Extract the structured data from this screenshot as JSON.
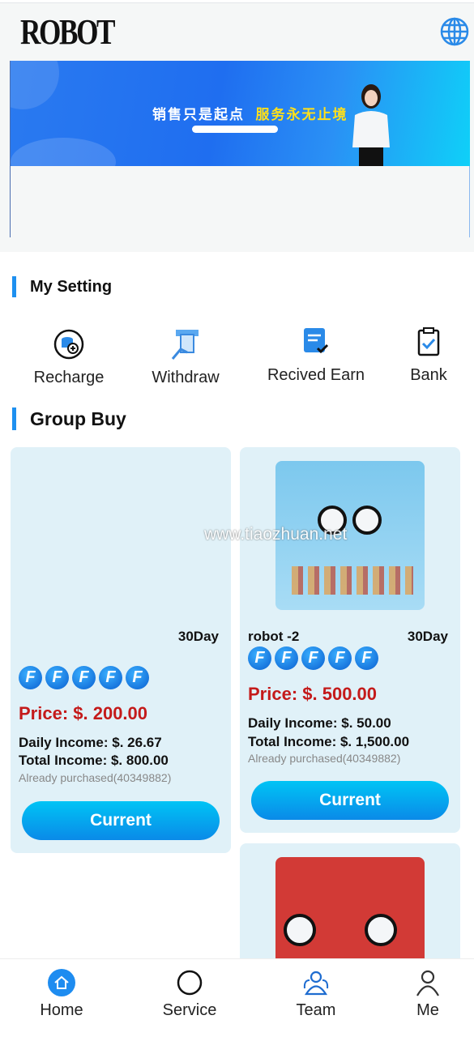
{
  "header": {
    "logo": "ROBOT",
    "language_icon": "globe-icon"
  },
  "banner": {
    "text_white": "销售只是起点",
    "text_yellow": "服务永无止境"
  },
  "my_setting": {
    "title": "My Setting",
    "actions": [
      {
        "label": "Recharge",
        "icon": "coin-plus-icon"
      },
      {
        "label": "Withdraw",
        "icon": "atm-icon"
      },
      {
        "label": "Recived Earn",
        "icon": "document-check-icon"
      },
      {
        "label": "Bank",
        "icon": "clipboard-check-icon"
      }
    ]
  },
  "group_buy": {
    "title": "Group Buy",
    "products": [
      {
        "name": "",
        "days": "30Day",
        "price": "Price: $. 200.00",
        "daily": "Daily Income: $. 26.67",
        "total": "Total Income: $. 800.00",
        "purchased": "Already purchased(40349882)",
        "button": "Current",
        "rating": 5
      },
      {
        "name": "robot -2",
        "days": "30Day",
        "price": "Price: $. 500.00",
        "daily": "Daily Income: $. 50.00",
        "total": "Total Income: $. 1,500.00",
        "purchased": "Already purchased(40349882)",
        "button": "Current",
        "rating": 5
      }
    ]
  },
  "watermark": "www.tiaozhuan.net",
  "nav": [
    {
      "label": "Home",
      "icon": "home-icon"
    },
    {
      "label": "Service",
      "icon": "circle-icon"
    },
    {
      "label": "Team",
      "icon": "team-icon"
    },
    {
      "label": "Me",
      "icon": "user-icon"
    }
  ],
  "colors": {
    "accent": "#1e90f0",
    "price": "#c41a1a",
    "card_bg": "#e0f1f8"
  }
}
